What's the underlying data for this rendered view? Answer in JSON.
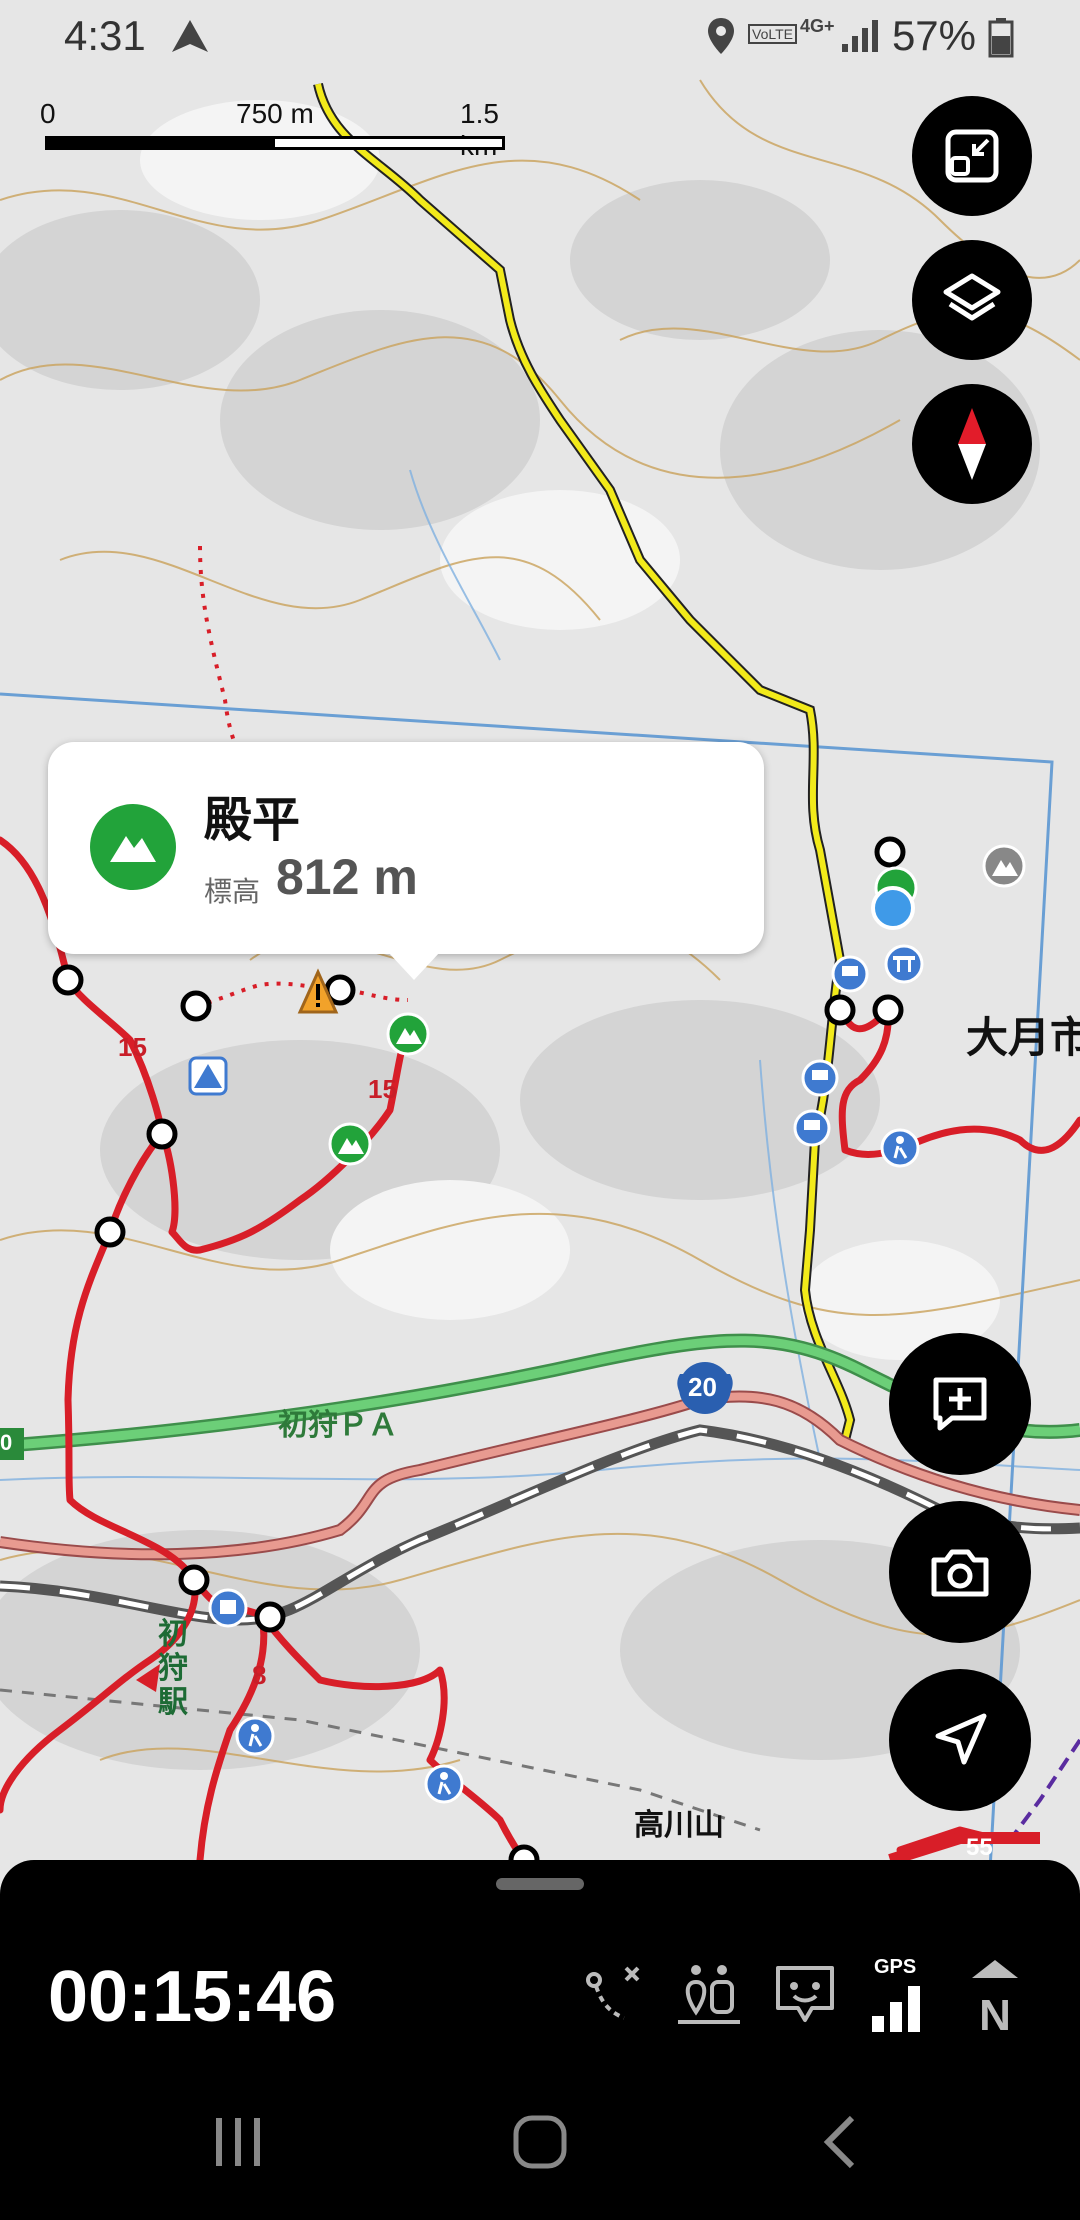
{
  "status_bar": {
    "time": "4:31",
    "battery": "57%",
    "network": "4G+",
    "volte": "VoLTE"
  },
  "scale_bar": {
    "start": "0",
    "mid": "750 m",
    "end": "1.5 km"
  },
  "popup": {
    "peak_name": "殿平",
    "elevation_label": "標高",
    "elevation_value": "812 m",
    "icon": "mountain-icon"
  },
  "map_labels": {
    "pa": "初狩ＰＡ",
    "route_20": "20",
    "route_15a": "15",
    "route_15b": "15",
    "route_8": "8",
    "station": "初狩駅",
    "city": "大月市",
    "mountain": "高川山",
    "edge_number": "0",
    "edge_55": "55"
  },
  "toolbar_buttons": [
    "fullscreen-exit-icon",
    "layers-icon",
    "compass-icon"
  ],
  "action_buttons": [
    "add-note-icon",
    "camera-icon",
    "navigate-icon"
  ],
  "bottom_sheet": {
    "timer": "00:15:46",
    "gps_label": "GPS",
    "north_label": "N"
  },
  "colors": {
    "trail_red": "#d81e28",
    "road_yellow": "#f2ea1a",
    "expressway_green": "#5fbf6a",
    "peak_green": "#22a33a",
    "boundary_blue": "#6a9fd4"
  }
}
